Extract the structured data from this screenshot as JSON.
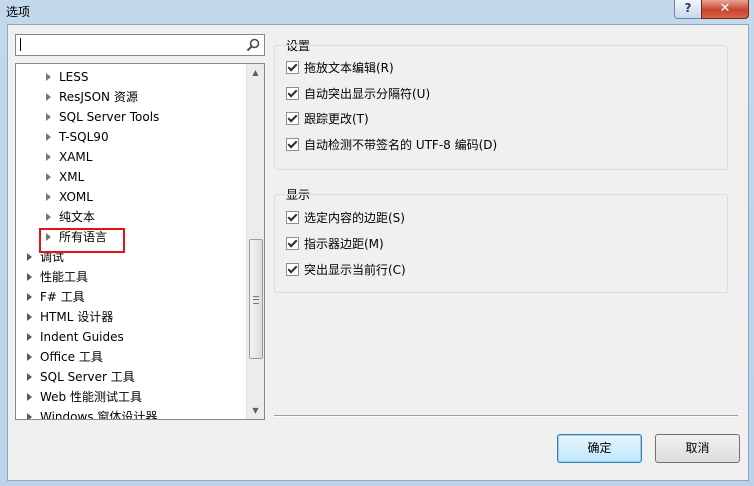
{
  "window": {
    "title": "选项",
    "help_label": "?",
    "close_label": "✕"
  },
  "search": {
    "value": "",
    "placeholder": ""
  },
  "tree": {
    "items": [
      {
        "label": "LESS",
        "level": 2
      },
      {
        "label": "ResJSON 资源",
        "level": 2
      },
      {
        "label": "SQL Server Tools",
        "level": 2
      },
      {
        "label": "T-SQL90",
        "level": 2
      },
      {
        "label": "XAML",
        "level": 2
      },
      {
        "label": "XML",
        "level": 2
      },
      {
        "label": "XOML",
        "level": 2
      },
      {
        "label": "纯文本",
        "level": 2
      },
      {
        "label": "所有语言",
        "level": 2
      },
      {
        "label": "调试",
        "level": 1
      },
      {
        "label": "性能工具",
        "level": 1
      },
      {
        "label": "F# 工具",
        "level": 1
      },
      {
        "label": "HTML 设计器",
        "level": 1
      },
      {
        "label": "Indent Guides",
        "level": 1
      },
      {
        "label": "Office 工具",
        "level": 1
      },
      {
        "label": "SQL Server 工具",
        "level": 1
      },
      {
        "label": "Web 性能测试工具",
        "level": 1
      },
      {
        "label": "Windows 窗体设计器",
        "level": 1
      }
    ]
  },
  "settings": {
    "label": "设置",
    "options": [
      {
        "label": "拖放文本编辑(R)",
        "checked": true
      },
      {
        "label": "自动突出显示分隔符(U)",
        "checked": true
      },
      {
        "label": "跟踪更改(T)",
        "checked": true
      },
      {
        "label": "自动检测不带签名的 UTF-8 编码(D)",
        "checked": true
      }
    ]
  },
  "display": {
    "label": "显示",
    "options": [
      {
        "label": "选定内容的边距(S)",
        "checked": true
      },
      {
        "label": "指示器边距(M)",
        "checked": true
      },
      {
        "label": "突出显示当前行(C)",
        "checked": true
      }
    ]
  },
  "buttons": {
    "ok": "确定",
    "cancel": "取消"
  }
}
